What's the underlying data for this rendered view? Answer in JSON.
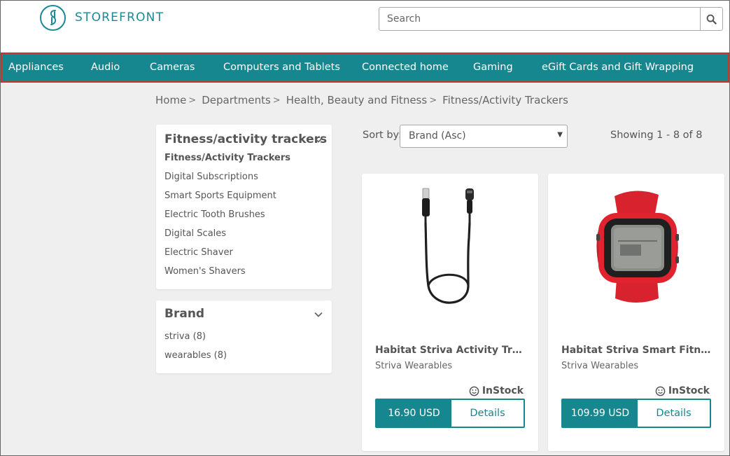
{
  "brand": {
    "name": "STOREFRONT"
  },
  "search": {
    "placeholder": "Search"
  },
  "nav": {
    "items": [
      {
        "label": "Appliances"
      },
      {
        "label": "Audio"
      },
      {
        "label": "Cameras"
      },
      {
        "label": "Computers and Tablets"
      },
      {
        "label": "Connected home"
      },
      {
        "label": "Gaming"
      },
      {
        "label": "eGift Cards and Gift Wrapping"
      }
    ]
  },
  "breadcrumb": {
    "items": [
      "Home",
      "Departments",
      "Health, Beauty and Fitness",
      "Fitness/Activity Trackers"
    ],
    "separator": ">"
  },
  "category_panel": {
    "title": "Fitness/activity trackers",
    "items": [
      {
        "label": "Fitness/Activity Trackers",
        "active": true
      },
      {
        "label": "Digital Subscriptions"
      },
      {
        "label": "Smart Sports Equipment"
      },
      {
        "label": "Electric Tooth Brushes"
      },
      {
        "label": "Digital Scales"
      },
      {
        "label": "Electric Shaver"
      },
      {
        "label": "Women's Shavers"
      }
    ]
  },
  "brand_panel": {
    "title": "Brand",
    "items": [
      {
        "label": "striva (8)"
      },
      {
        "label": "wearables (8)"
      }
    ]
  },
  "sort": {
    "label": "Sort by:",
    "value": "Brand (Asc)"
  },
  "results": {
    "showing": "Showing 1 - 8 of 8"
  },
  "products": [
    {
      "title": "Habitat Striva Activity Trac...",
      "brand": "Striva Wearables",
      "stock": "InStock",
      "price": "16.90 USD",
      "details_label": "Details",
      "image_icon": "charging-cable-image"
    },
    {
      "title": "Habitat Striva Smart Fitnes...",
      "brand": "Striva Wearables",
      "stock": "InStock",
      "price": "109.99 USD",
      "details_label": "Details",
      "image_icon": "red-smartwatch-image"
    }
  ],
  "colors": {
    "accent": "#16868f",
    "nav_outline": "#c0392b",
    "background": "#efefef"
  }
}
